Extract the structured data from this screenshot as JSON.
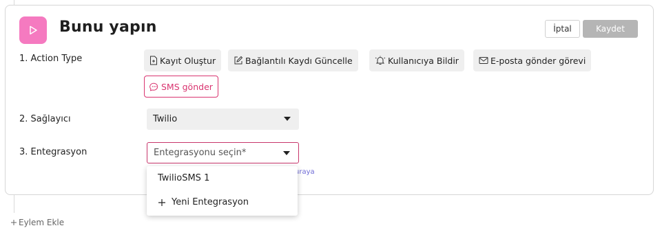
{
  "action": {
    "title": "Bunu yapın",
    "cancel_label": "İptal",
    "save_label": "Kaydet",
    "icon": "play-icon",
    "accent_color": "#f57ac0"
  },
  "fields": {
    "action_type": {
      "label": "1. Action Type",
      "options": [
        {
          "label": "Kayıt Oluştur",
          "icon": "file-plus-icon"
        },
        {
          "label": "Bağlantılı Kaydı Güncelle",
          "icon": "edit-icon"
        },
        {
          "label": "Kullanıcıya Bildir",
          "icon": "bell-icon"
        },
        {
          "label": "E-posta gönder görevi",
          "icon": "mail-icon"
        },
        {
          "label": "SMS gönder",
          "icon": "message-icon",
          "selected": true
        }
      ],
      "selected_color": "#d9336f"
    },
    "provider": {
      "label": "2. Sağlayıcı",
      "value": "Twilio"
    },
    "integration": {
      "label": "3. Entegrasyon",
      "placeholder": "Entegrasyonu seçin*",
      "helper_visible": "uraya",
      "dropdown_items": [
        {
          "label": "TwilioSMS 1"
        },
        {
          "label": "Yeni Entegrasyon",
          "icon": "plus-icon"
        }
      ]
    }
  },
  "footer": {
    "add_action_label": "Eylem Ekle",
    "icon": "plus-icon"
  }
}
